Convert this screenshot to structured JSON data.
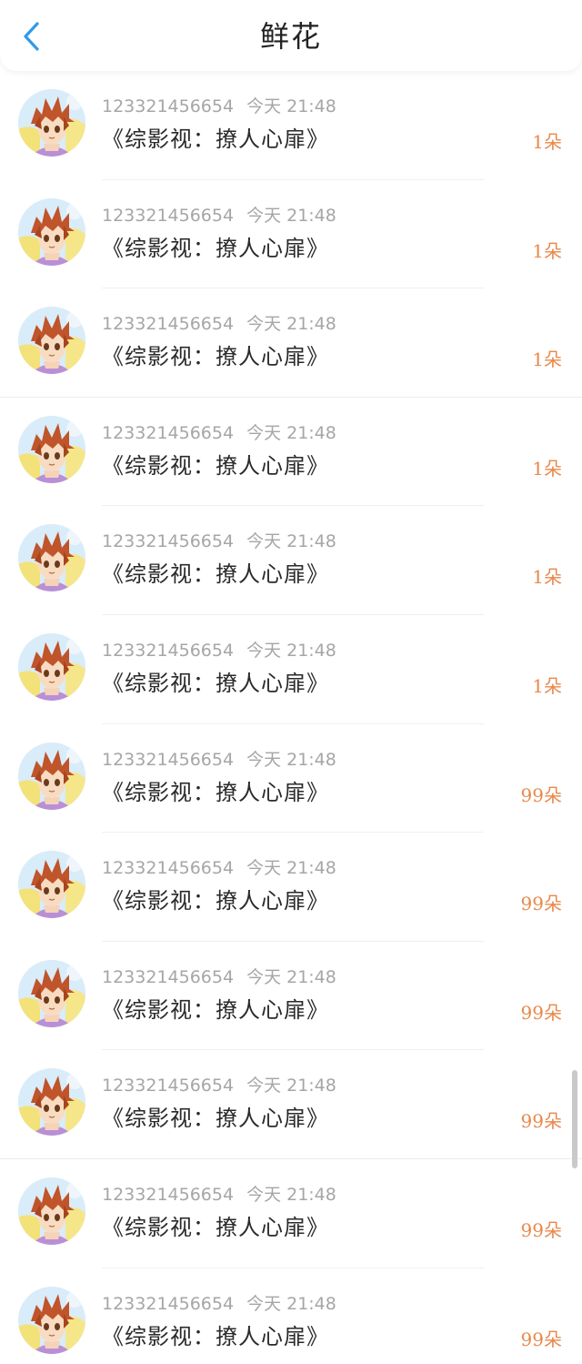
{
  "header": {
    "title": "鲜花",
    "back_icon": "chevron-left-icon",
    "accent_color": "#2f9be8"
  },
  "list": {
    "items": [
      {
        "user": "123321456654",
        "time": "今天 21:48",
        "book": "《综影视：撩人心扉》",
        "count": "1朵"
      },
      {
        "user": "123321456654",
        "time": "今天 21:48",
        "book": "《综影视：撩人心扉》",
        "count": "1朵"
      },
      {
        "user": "123321456654",
        "time": "今天 21:48",
        "book": "《综影视：撩人心扉》",
        "count": "1朵"
      },
      {
        "user": "123321456654",
        "time": "今天 21:48",
        "book": "《综影视：撩人心扉》",
        "count": "1朵"
      },
      {
        "user": "123321456654",
        "time": "今天 21:48",
        "book": "《综影视：撩人心扉》",
        "count": "1朵"
      },
      {
        "user": "123321456654",
        "time": "今天 21:48",
        "book": "《综影视：撩人心扉》",
        "count": "1朵"
      },
      {
        "user": "123321456654",
        "time": "今天 21:48",
        "book": "《综影视：撩人心扉》",
        "count": "99朵"
      },
      {
        "user": "123321456654",
        "time": "今天 21:48",
        "book": "《综影视：撩人心扉》",
        "count": "99朵"
      },
      {
        "user": "123321456654",
        "time": "今天 21:48",
        "book": "《综影视：撩人心扉》",
        "count": "99朵"
      },
      {
        "user": "123321456654",
        "time": "今天 21:48",
        "book": "《综影视：撩人心扉》",
        "count": "99朵"
      },
      {
        "user": "123321456654",
        "time": "今天 21:48",
        "book": "《综影视：撩人心扉》",
        "count": "99朵"
      },
      {
        "user": "123321456654",
        "time": "今天 21:48",
        "book": "《综影视：撩人心扉》",
        "count": "99朵"
      }
    ]
  },
  "colors": {
    "count": "#e8884a",
    "meta": "#a6a6a6",
    "title": "#2a2a2a"
  }
}
